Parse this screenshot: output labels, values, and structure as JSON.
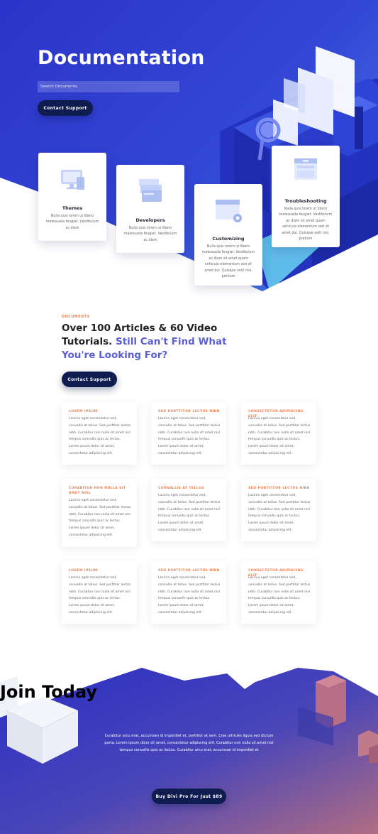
{
  "hero": {
    "title": "Documentation",
    "search_placeholder": "Search Documents",
    "contact_button": "Contact Support"
  },
  "categories": [
    {
      "title": "Themes",
      "text": "Nulla quis lorem ut libero malesuada feugiat. Vestibulum ac diam",
      "icon": "monitor-devices-icon"
    },
    {
      "title": "Developers",
      "text": "Nulla quis lorem ut libero malesuada feugiat. Vestibulum ac diam",
      "icon": "stacked-windows-icon"
    },
    {
      "title": "Customizing",
      "text": "Nulla quis lorem ut libero malesuada feugiat. Vestibulum ac diam sit amet quam vehicula elementum sed sit amet dui. Quisque velit nisi, pretium",
      "icon": "window-gear-icon"
    },
    {
      "title": "Troubleshooting",
      "text": "Nulla quis lorem ut libero malesuada feugiat. Vestibulum ac diam sit amet quam vehicula elementum sed sit amet dui. Quisque velit nisi, pretium",
      "icon": "browser-window-icon"
    }
  ],
  "articles_section": {
    "label": "DOCUMENTS",
    "headline_main": "Over 100 Articles & 60 Video Tutorials.",
    "headline_accent": "Still Can't Find What You're Looking For?",
    "contact_button": "Contact Support"
  },
  "articles": [
    {
      "title": "LOREM IPSUM",
      "text": "Lacinia eget consectetur sed, convallis at tellus. Sed porttitor lectus nibh. Curabitur non nulla sit amet nisl tempus convallis quis ac lectus. Lorem ipsum dolor sit amet, consectetur adipiscing elit."
    },
    {
      "title": "SED PORTTITOR LECTUS NIBH",
      "text": "Lacinia eget consectetur sed, convallis at tellus. Sed porttitor lectus nibh. Curabitur non nulla sit amet nisl tempus convallis quis ac lectus. Lorem ipsum dolor sit amet, consectetur adipiscing elit."
    },
    {
      "title": "CONSECTETUR ADIPISCING ELIT",
      "text": "Lacinia eget consectetur sed, convallis at tellus. Sed porttitor lectus nibh. Curabitur non nulla sit amet nisl tempus convallis quis ac lectus. Lorem ipsum dolor sit amet, consectetur adipiscing elit."
    },
    {
      "title": "CURABITUR NON NULLA SIT AMET NISL",
      "text": "Lacinia eget consectetur sed, convallis at tellus. Sed porttitor lectus nibh. Curabitur non nulla sit amet nisl tempus convallis quis ac lectus. Lorem ipsum dolor sit amet, consectetur adipiscing elit."
    },
    {
      "title": "CONVALLIS AT TELLUS",
      "text": "Lacinia eget consectetur sed, convallis at tellus. Sed porttitor lectus nibh. Curabitur non nulla sit amet nisl tempus convallis quis ac lectus. Lorem ipsum dolor sit amet, consectetur adipiscing elit."
    },
    {
      "title": "SED PORTTITOR LECTUS NIBH",
      "text": "Lacinia eget consectetur sed, convallis at tellus. Sed porttitor lectus nibh. Curabitur non nulla sit amet nisl tempus convallis quis ac lectus. Lorem ipsum dolor sit amet, consectetur adipiscing elit."
    },
    {
      "title": "LOREM IPSUM",
      "text": "Lacinia eget consectetur sed, convallis at tellus. Sed porttitor lectus nibh. Curabitur non nulla sit amet nisl tempus convallis quis ac lectus. Lorem ipsum dolor sit amet, consectetur adipiscing elit."
    },
    {
      "title": "SED PORTTITOR LECTUS NIBH",
      "text": "Lacinia eget consectetur sed, convallis at tellus. Sed porttitor lectus nibh. Curabitur non nulla sit amet nisl tempus convallis quis ac lectus. Lorem ipsum dolor sit amet, consectetur adipiscing elit."
    },
    {
      "title": "CONSECTETUR ADIPISCING ELIT",
      "text": "Lacinia eget consectetur sed, convallis at tellus. Sed porttitor lectus nibh. Curabitur non nulla sit amet nisl tempus convallis quis ac lectus. Lorem ipsum dolor sit amet, consectetur adipiscing elit."
    }
  ],
  "join": {
    "title": "Join Today",
    "text": "Curabitur arcu erat, accumsan id imperdiet et, porttitor at sem. Cras ultricies ligula sed dictum porta. Lorem ipsum dolor sit amet, consectetur adipiscing elit. Curabitur non nulla sit amet nisl tempus convallis quis ac lectus. Curabitur arcu erat, accumsan id imperdiet et",
    "button": "Buy Divi Pro For Just $89"
  },
  "colors": {
    "hero_blue": "#3040d0",
    "navy_button": "#0f1c4f",
    "accent_orange": "#f07f4f",
    "accent_purple": "#5b5fd6"
  }
}
